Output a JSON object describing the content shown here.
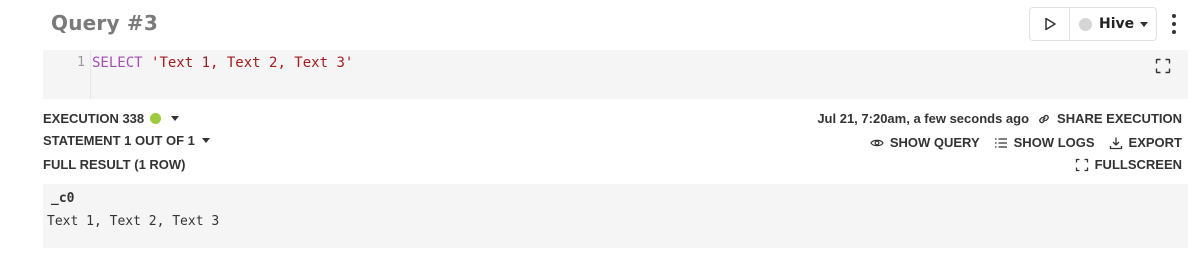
{
  "query": {
    "title": "Query #3",
    "engine": "Hive",
    "line_number": "1",
    "code_keyword": "SELECT",
    "code_string": "'Text 1, Text 2, Text 3'"
  },
  "execution": {
    "label": "EXECUTION 338",
    "status_color": "#9ccc3b",
    "statement_label": "STATEMENT 1 OUT OF 1",
    "result_label": "FULL RESULT (1 ROW)",
    "timestamp": "Jul 21, 7:20am, a few seconds ago",
    "share_label": "SHARE EXECUTION",
    "show_query_label": "SHOW QUERY",
    "show_logs_label": "SHOW LOGS",
    "export_label": "EXPORT",
    "fullscreen_label": "FULLSCREEN"
  },
  "result": {
    "columns": [
      "_c0"
    ],
    "rows": [
      [
        "Text 1, Text 2, Text 3"
      ]
    ]
  },
  "icons": {
    "run": "play-icon",
    "menu": "kebab-icon",
    "expand": "expand-icon",
    "share": "link-icon",
    "show_query": "eye-icon",
    "show_logs": "list-icon",
    "export": "download-icon",
    "fullscreen": "fullscreen-icon"
  }
}
